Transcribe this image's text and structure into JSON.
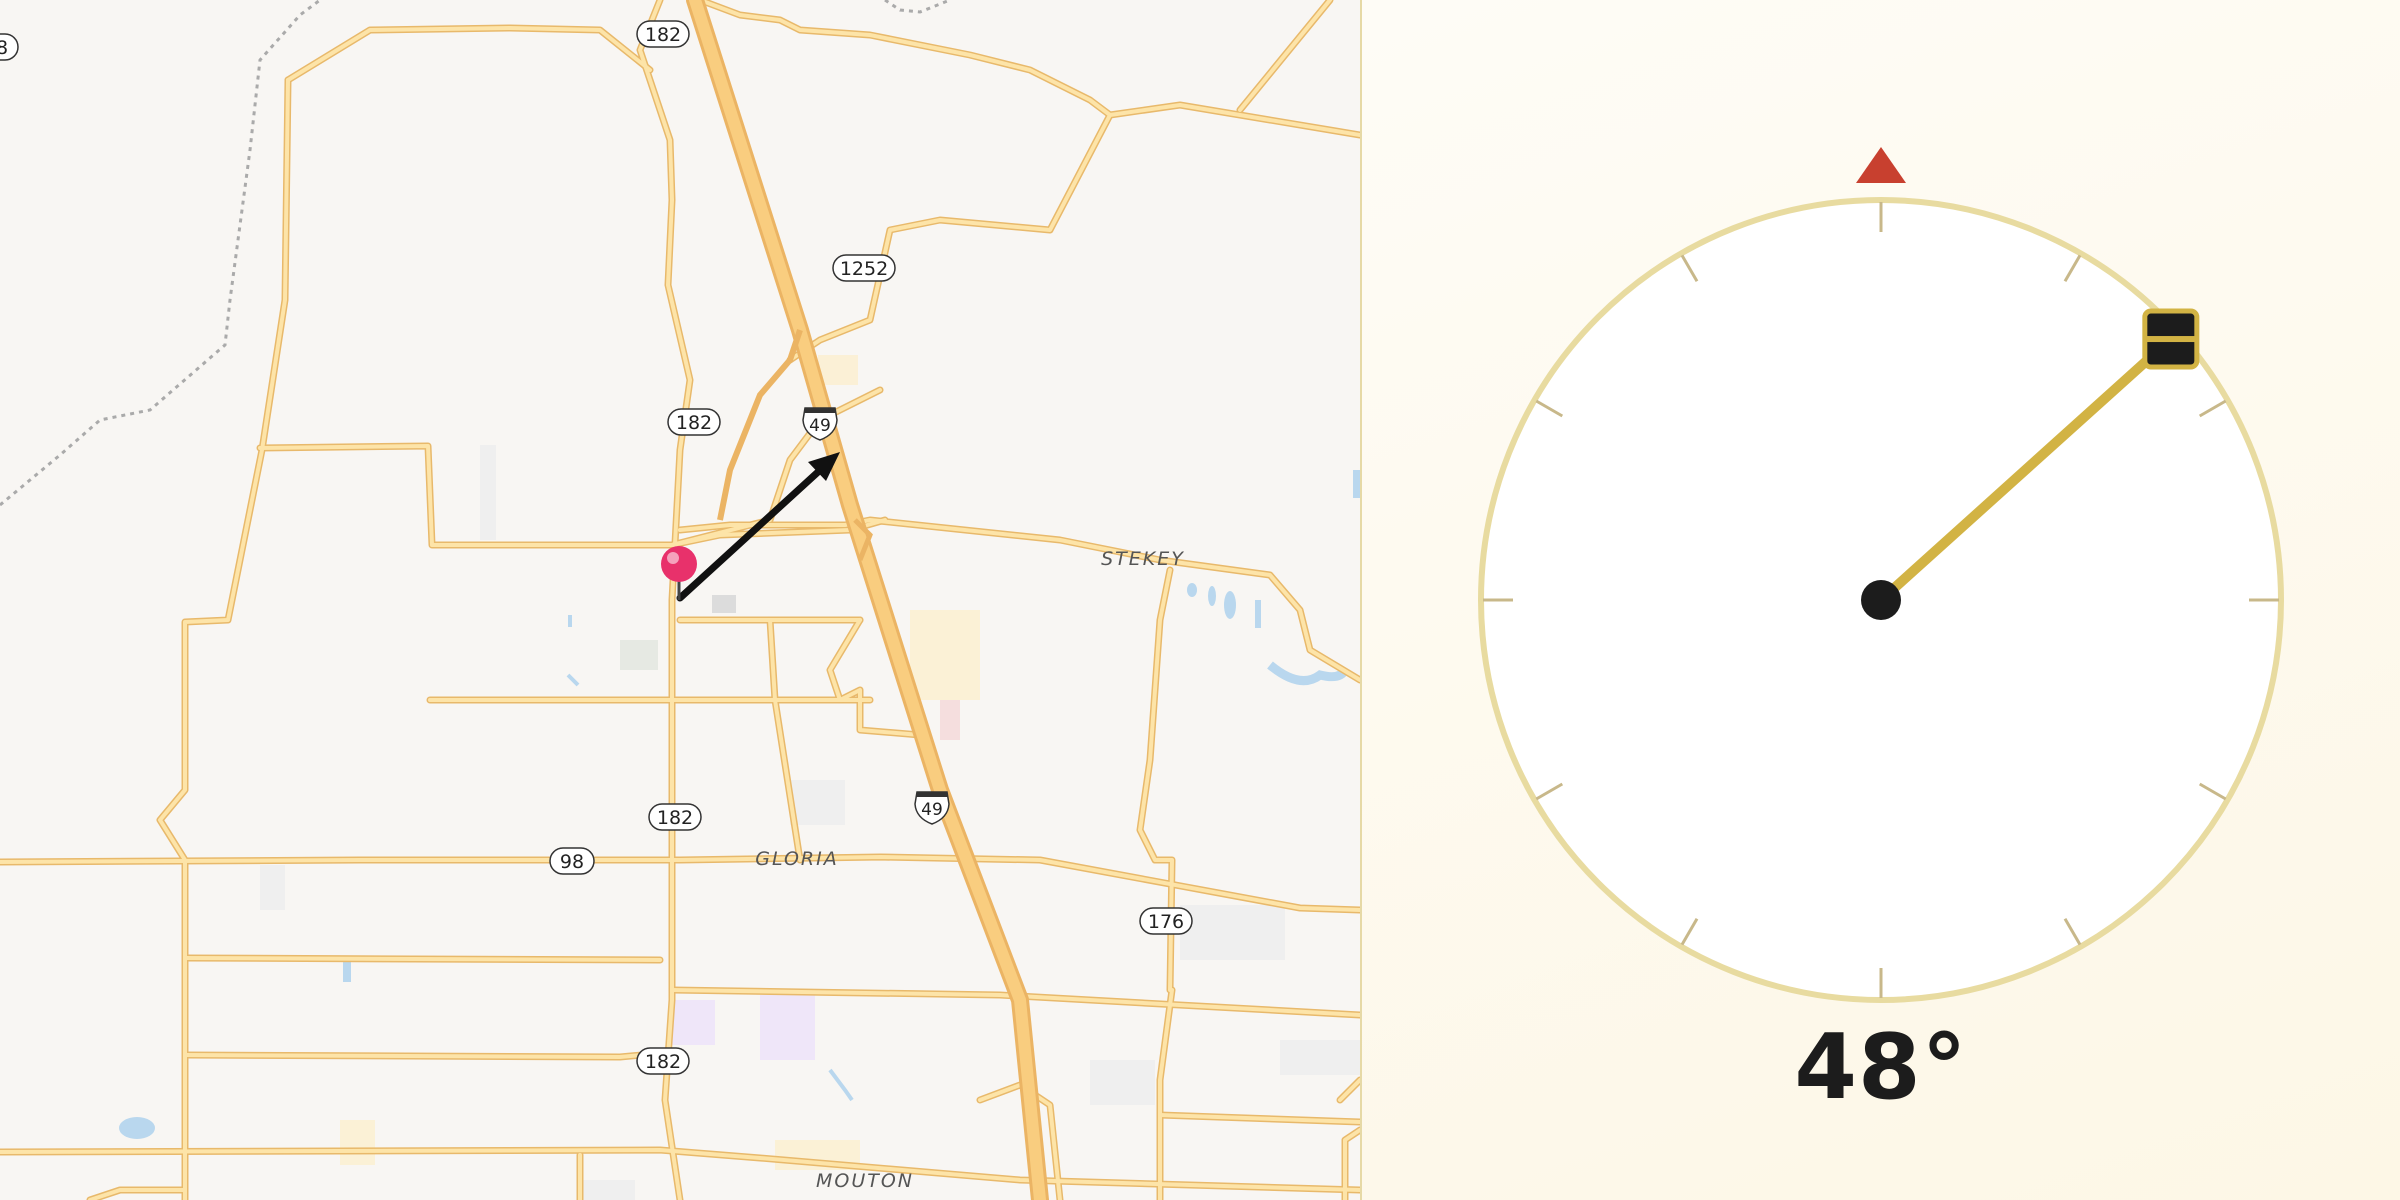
{
  "map": {
    "highway_shields": [
      {
        "id": "shield-182-top",
        "label": "182"
      },
      {
        "id": "shield-1252",
        "label": "1252"
      },
      {
        "id": "shield-182-mid",
        "label": "182"
      },
      {
        "id": "shield-182-lower",
        "label": "182"
      },
      {
        "id": "shield-98",
        "label": "98"
      },
      {
        "id": "shield-176",
        "label": "176"
      },
      {
        "id": "shield-182-bottom",
        "label": "182"
      },
      {
        "id": "shield-edge",
        "label": "8"
      }
    ],
    "interstate_shields": [
      {
        "id": "i49-north",
        "label": "49"
      },
      {
        "id": "i49-south",
        "label": "49"
      }
    ],
    "places": [
      {
        "id": "place-stekey",
        "label": "STEKEY"
      },
      {
        "id": "place-gloria",
        "label": "GLORIA"
      },
      {
        "id": "place-mouton",
        "label": "MOUTON"
      }
    ],
    "colors": {
      "land": "#f8f6f3",
      "road": "#f7c867",
      "road_casing": "#ecc078",
      "interstate": "#f4b95f",
      "water": "#b9d7ee",
      "pin": "#e8316b",
      "arrow": "#111111"
    }
  },
  "compass": {
    "heading_degrees": 48,
    "heading_label": "48°",
    "north_marker_color": "#c8402f",
    "needle_color": "#d2b344",
    "dial_ring_color": "#e8dba0",
    "dial_face_color": "#ffffff"
  }
}
